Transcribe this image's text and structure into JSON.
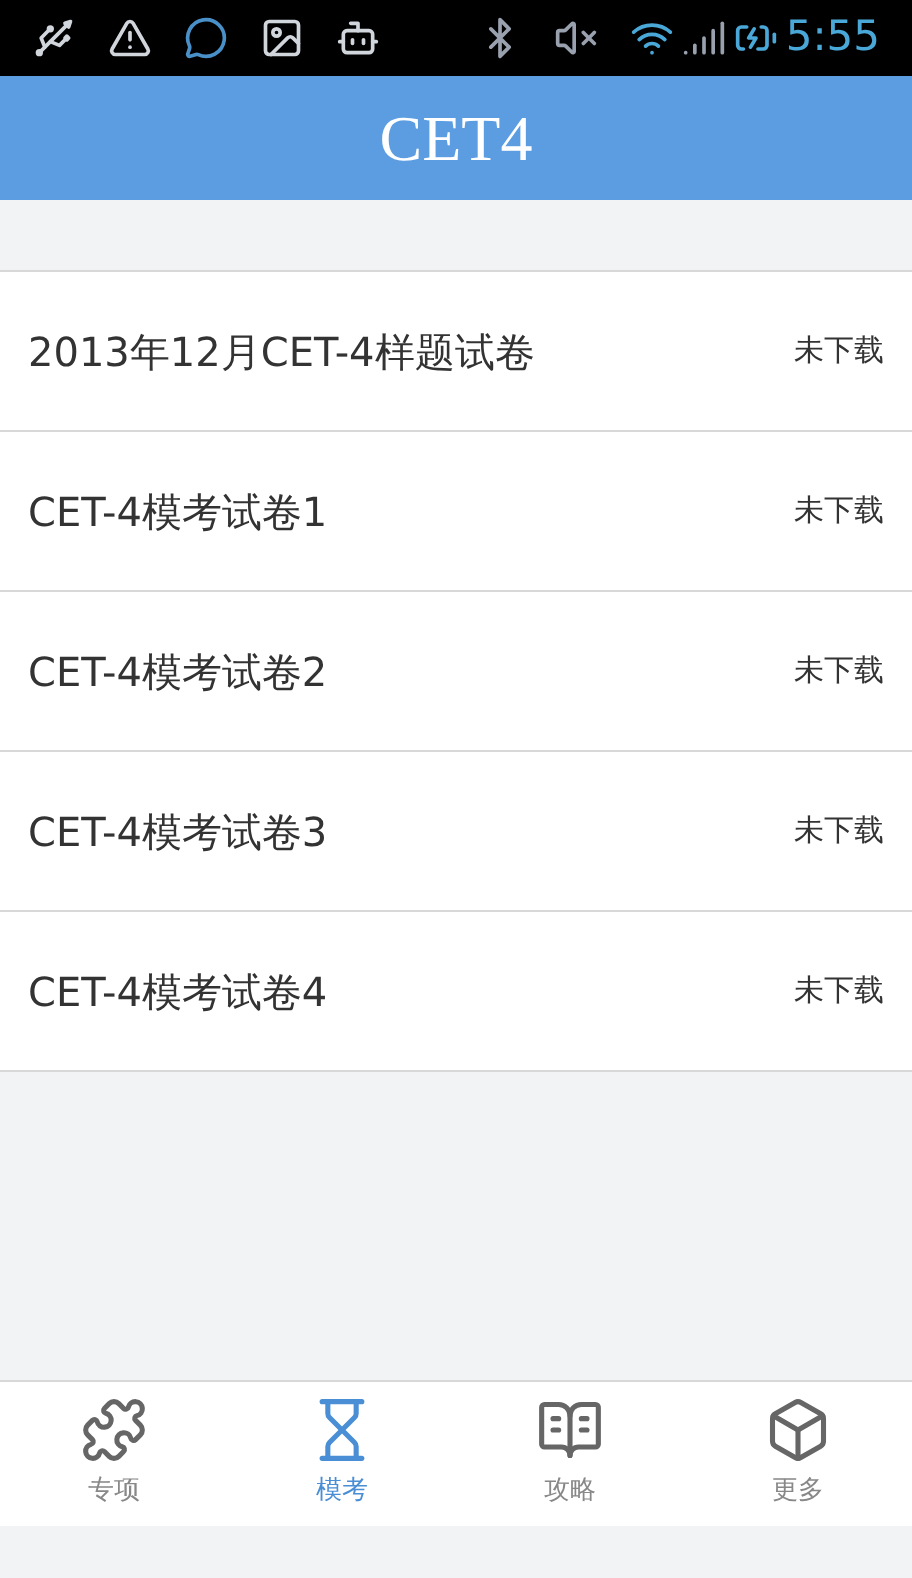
{
  "status_bar": {
    "time": "5:55"
  },
  "header": {
    "title": "CET4"
  },
  "papers": [
    {
      "title": "2013年12月CET-4样题试卷",
      "status": "未下载"
    },
    {
      "title": "CET-4模考试卷1",
      "status": "未下载"
    },
    {
      "title": "CET-4模考试卷2",
      "status": "未下载"
    },
    {
      "title": "CET-4模考试卷3",
      "status": "未下载"
    },
    {
      "title": "CET-4模考试卷4",
      "status": "未下载"
    }
  ],
  "tabs": [
    {
      "label": "专项",
      "kind": "puzzle",
      "selected": false
    },
    {
      "label": "模考",
      "kind": "hourglass",
      "selected": true
    },
    {
      "label": "攻略",
      "kind": "book",
      "selected": false
    },
    {
      "label": "更多",
      "kind": "cube",
      "selected": false
    }
  ]
}
